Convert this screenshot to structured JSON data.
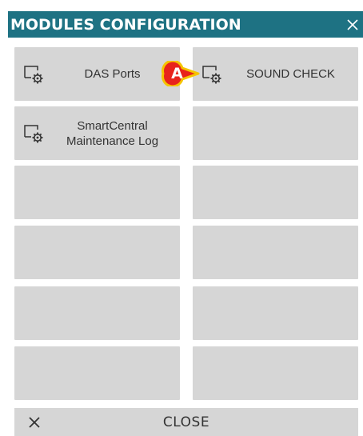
{
  "dialog": {
    "title": "MODULES CONFIGURATION",
    "close_icon": "close-icon"
  },
  "tiles": [
    {
      "label": "DAS Ports",
      "icon": "module-settings-icon"
    },
    {
      "label": "SOUND CHECK",
      "icon": "module-settings-icon"
    },
    {
      "label": "SmartCentral Maintenance Log",
      "icon": "module-settings-icon"
    },
    {
      "label": ""
    },
    {
      "label": ""
    },
    {
      "label": ""
    },
    {
      "label": ""
    },
    {
      "label": ""
    },
    {
      "label": ""
    },
    {
      "label": ""
    },
    {
      "label": ""
    },
    {
      "label": ""
    }
  ],
  "footer": {
    "close_label": "CLOSE",
    "close_icon": "close-icon"
  },
  "callout": {
    "letter": "A"
  },
  "colors": {
    "titlebar": "#1e7283",
    "tile": "#d6d6d6",
    "callout_fill": "#e8231c",
    "callout_border": "#f5c400"
  }
}
